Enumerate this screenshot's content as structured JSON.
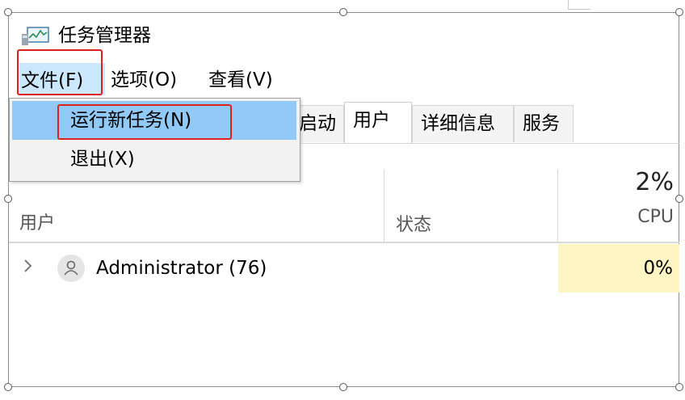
{
  "window": {
    "title": "任务管理器",
    "icon": "task-manager-icon"
  },
  "menubar": {
    "file": "文件(F)",
    "options": "选项(O)",
    "view": "查看(V)"
  },
  "file_menu": {
    "items": [
      {
        "label": "运行新任务(N)",
        "highlighted": true
      },
      {
        "label": "退出(X)",
        "highlighted": false
      }
    ]
  },
  "tabs": [
    {
      "label": "启动",
      "active": false
    },
    {
      "label": "用户",
      "active": true
    },
    {
      "label": "详细信息",
      "active": false
    },
    {
      "label": "服务",
      "active": false
    }
  ],
  "table": {
    "columns": {
      "user": "用户",
      "status": "状态",
      "cpu_total": "2%",
      "cpu_label": "CPU"
    },
    "rows": [
      {
        "name": "Administrator (76)",
        "status": "",
        "cpu": "0%"
      }
    ]
  },
  "colors": {
    "menu_highlight": "#cce8ff",
    "dropdown_selected": "#91c9f7",
    "annotation_red": "#e02020",
    "cpu_cell": "#fff4c4"
  }
}
